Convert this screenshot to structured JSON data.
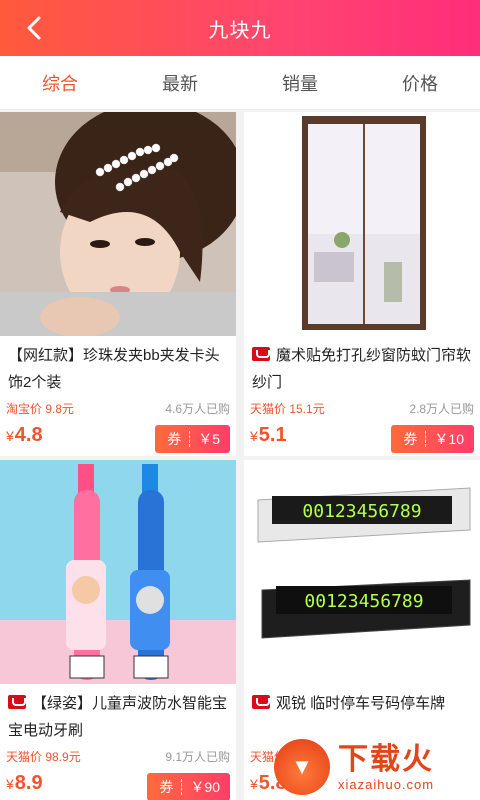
{
  "header": {
    "title": "九块九",
    "back_icon": "chevron-left-icon"
  },
  "tabs": [
    {
      "label": "综合",
      "active": true
    },
    {
      "label": "最新",
      "active": false
    },
    {
      "label": "销量",
      "active": false
    },
    {
      "label": "价格",
      "active": false
    }
  ],
  "products": [
    {
      "name": "【网红款】珍珠发夹bb夹发卡头饰2个装",
      "platform_badge": false,
      "orig_label": "淘宝价 9.8元",
      "sold": "4.6万人已购",
      "price": "4.8",
      "coupon": "券",
      "coupon_value": "￥5"
    },
    {
      "name": "魔术贴免打孔纱窗防蚊门帘软纱门",
      "platform_badge": true,
      "orig_label": "天猫价 15.1元",
      "sold": "2.8万人已购",
      "price": "5.1",
      "coupon": "券",
      "coupon_value": "￥10"
    },
    {
      "name": "【绿姿】儿童声波防水智能宝宝电动牙刷",
      "platform_badge": true,
      "orig_label": "天猫价 98.9元",
      "sold": "9.1万人已购",
      "price": "8.9",
      "coupon": "券",
      "coupon_value": "￥90"
    },
    {
      "name": "观锐 临时停车号码停车牌",
      "platform_badge": true,
      "orig_label": "天猫价",
      "sold": "",
      "price": "5.8",
      "coupon": "",
      "coupon_value": ""
    }
  ],
  "currency_symbol": "¥",
  "parking_sign_digits": "00123456789",
  "watermark": {
    "text": "下载火",
    "sub": "xiazaihuo.com"
  },
  "colors": {
    "accent": "#f0542d",
    "header_start": "#ff5a3c",
    "header_end": "#ff2d7a"
  }
}
